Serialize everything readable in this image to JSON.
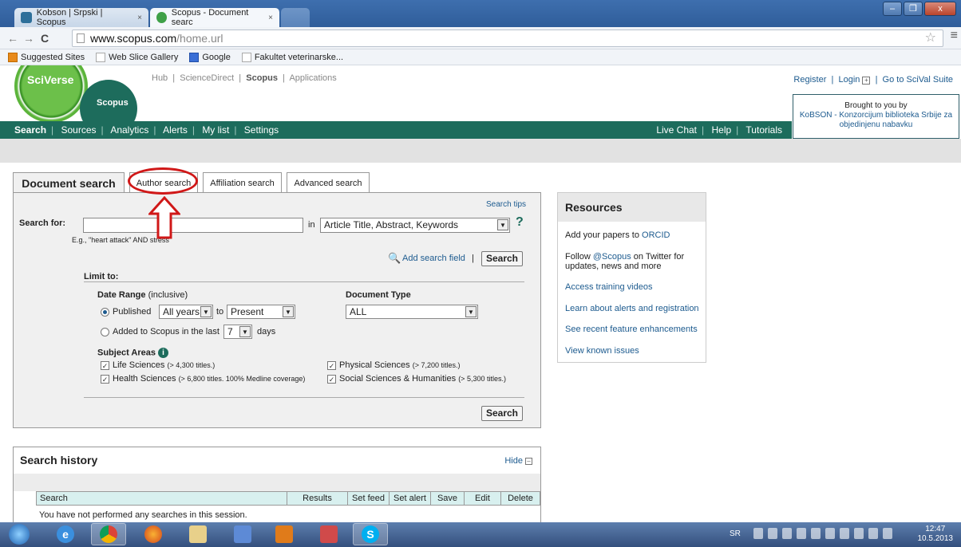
{
  "browser": {
    "tabs": [
      {
        "label": "Kobson | Srpski | Scopus",
        "close": "×"
      },
      {
        "label": "Scopus - Document searc",
        "close": "×"
      }
    ],
    "window_buttons": {
      "minimize": "–",
      "maximize": "❐",
      "close": "x"
    },
    "nav": {
      "back": "←",
      "forward": "→",
      "reload": "C"
    },
    "url_host": "www.scopus.com",
    "url_path": "/home.url",
    "star": "☆",
    "menu": "≡",
    "bookmarks": [
      "Suggested Sites",
      "Web Slice Gallery",
      "Google",
      "Fakultet veterinarske..."
    ]
  },
  "header": {
    "logo_sciverse": "SciVerse",
    "logo_scopus": "Scopus",
    "topnav": {
      "hub": "Hub",
      "sciencedirect": "ScienceDirect",
      "scopus": "Scopus",
      "applications": "Applications"
    },
    "user_links": {
      "register": "Register",
      "login": "Login",
      "scival": "Go to SciVal Suite"
    },
    "brought_line1": "Brought to you by",
    "brought_line2": "KoBSON - Konzorcijum biblioteka Srbije za",
    "brought_line3": "objedinjenu nabavku"
  },
  "mainnav": {
    "items": [
      "Search",
      "Sources",
      "Analytics",
      "Alerts",
      "My list",
      "Settings"
    ],
    "right": [
      "Live Chat",
      "Help",
      "Tutorials"
    ]
  },
  "search": {
    "tabs": [
      "Document search",
      "Author search",
      "Affiliation search",
      "Advanced search"
    ],
    "search_tips": "Search tips",
    "search_for": "Search for:",
    "query_value": "",
    "in_label": "in",
    "field_select": "Article Title, Abstract, Keywords",
    "help": "?",
    "example": "E.g., \"heart attack\" AND stress",
    "add_field": "Add search field",
    "search_button": "Search",
    "limit_to": "Limit to:",
    "date_range": "Date Range",
    "date_range_note": "(inclusive)",
    "published": "Published",
    "years_from": "All years",
    "to": "to",
    "years_to": "Present",
    "added_label": "Added to Scopus in the last",
    "days_value": "7",
    "days": "days",
    "doc_type_label": "Document Type",
    "doc_type": "ALL",
    "subject_areas": "Subject Areas",
    "subjects": [
      {
        "name": "Life Sciences",
        "note": "(> 4,300 titles.)"
      },
      {
        "name": "Health Sciences",
        "note": "(> 6,800 titles. 100% Medline coverage)"
      },
      {
        "name": "Physical Sciences",
        "note": "(> 7,200 titles.)"
      },
      {
        "name": "Social Sciences & Humanities",
        "note": "(> 5,300 titles.)"
      }
    ]
  },
  "resources": {
    "title": "Resources",
    "orcid_prefix": "Add your papers to",
    "orcid_link": "ORCID",
    "follow_prefix": "Follow",
    "follow_link": "@Scopus",
    "follow_suffix1": "on Twitter for",
    "follow_suffix2": "updates, news and more",
    "items": [
      "Access training videos",
      "Learn about alerts and registration",
      "See recent feature enhancements",
      "View known issues"
    ]
  },
  "history": {
    "title": "Search history",
    "hide": "Hide",
    "columns": [
      "Search",
      "Results",
      "Set feed",
      "Set alert",
      "Save",
      "Edit",
      "Delete"
    ],
    "empty_message": "You have not performed any searches in this session."
  },
  "taskbar": {
    "lang": "SR",
    "time": "12:47",
    "date": "10.5.2013"
  }
}
